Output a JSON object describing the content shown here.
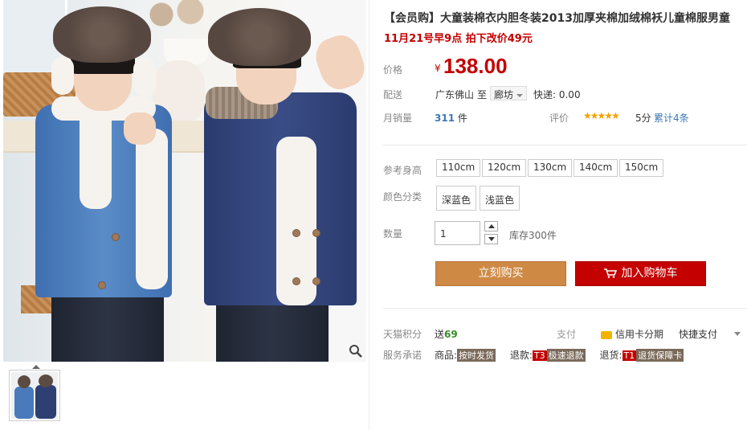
{
  "product": {
    "title": "【会员购】大童装棉衣内胆冬装2013加厚夹棉加绒棉袄儿童棉服男童",
    "promo": "11月21号早9点 拍下改价49元"
  },
  "price": {
    "label": "价格",
    "currency": "¥",
    "value": "138.00"
  },
  "shipping": {
    "label": "配送",
    "from": "广东佛山",
    "to_word": "至",
    "destination": "廊坊",
    "fee": "快递: 0.00"
  },
  "sales": {
    "label": "月销量",
    "count": "311",
    "unit": "件",
    "rating_label": "评价",
    "stars": "★★★★★",
    "score": "5分",
    "reviews": "累计4条"
  },
  "size": {
    "label": "参考身高",
    "options": [
      "110cm",
      "120cm",
      "130cm",
      "140cm",
      "150cm"
    ]
  },
  "color": {
    "label": "颜色分类",
    "options": [
      "深蓝色",
      "浅蓝色"
    ]
  },
  "quantity": {
    "label": "数量",
    "value": "1",
    "stock": "库存300件"
  },
  "buttons": {
    "buy_now": "立刻购买",
    "add_to_cart": "加入购物车"
  },
  "tmall_points": {
    "label": "天猫积分",
    "prefix": "送",
    "value": "69"
  },
  "payment": {
    "label": "支付",
    "credit_card": "信用卡分期",
    "quick": "快捷支付"
  },
  "service": {
    "label": "服务承诺",
    "goods_prefix": "商品:",
    "goods_tag": "按时发货",
    "refund_prefix": "退款:",
    "refund_code": "T3",
    "refund_tag": "极速退款",
    "return_prefix": "退货:",
    "return_code": "T1",
    "return_tag": "退货保障卡"
  },
  "colors": {
    "price_red": "#c40000",
    "buy_button": "#ce8a45",
    "cart_button": "#c40000",
    "link_blue": "#3c78b5",
    "star": "#f3a300"
  },
  "icons": [
    "zoom-icon",
    "cart-icon",
    "credit-card-icon",
    "chevron-down-icon"
  ]
}
